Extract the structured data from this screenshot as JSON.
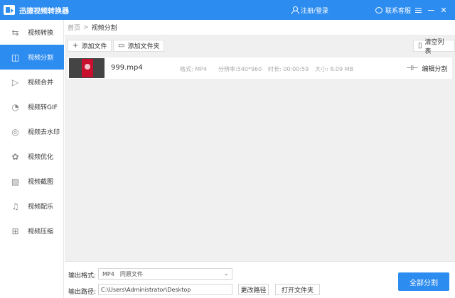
{
  "app": {
    "title": "迅捷视频转换器",
    "login": "注册/登录",
    "service": "联系客服"
  },
  "sidebar": {
    "items": [
      {
        "label": "视频转换",
        "icon": "video-convert-icon",
        "active": false
      },
      {
        "label": "视频分割",
        "icon": "video-split-icon",
        "active": true
      },
      {
        "label": "视频合并",
        "icon": "video-merge-icon",
        "active": false
      },
      {
        "label": "视频转GIF",
        "icon": "video-gif-icon",
        "active": false
      },
      {
        "label": "视频去水印",
        "icon": "watermark-icon",
        "active": false
      },
      {
        "label": "视频优化",
        "icon": "optimize-icon",
        "active": false
      },
      {
        "label": "视频截图",
        "icon": "screenshot-icon",
        "active": false
      },
      {
        "label": "视频配乐",
        "icon": "music-icon",
        "active": false
      },
      {
        "label": "视频压缩",
        "icon": "compress-icon",
        "active": false
      }
    ]
  },
  "breadcrumb": {
    "home": "首页",
    "sep": ">",
    "current": "视频分割"
  },
  "toolbar": {
    "add_file": "添加文件",
    "add_folder": "添加文件夹",
    "clear_list": "清空列表"
  },
  "files": [
    {
      "name": "999.mp4",
      "format": "格式: MP4",
      "resolution": "分辨率:540*960",
      "duration": "时长: 00:00:59",
      "size": "大小: 8.09 MB",
      "action": "编辑分割"
    }
  ],
  "output": {
    "format_label": "输出格式:",
    "format_value": "MP4",
    "format_extra": "同原文件",
    "path_label": "输出路径:",
    "path_value": "C:\\Users\\Administrator\\Desktop",
    "change_path": "更改路径",
    "open_folder": "打开文件夹",
    "convert_all": "全部分割"
  },
  "colors": {
    "accent": "#2d8cf0"
  }
}
